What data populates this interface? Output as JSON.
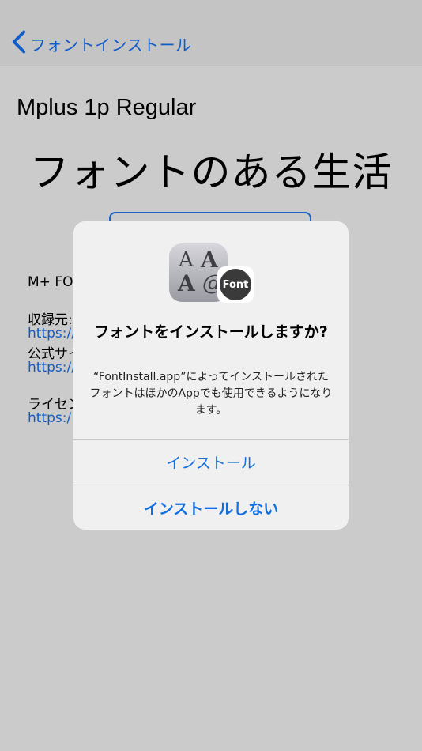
{
  "nav": {
    "back_label": "フォントインストール"
  },
  "font": {
    "name": "Mplus 1p Regular",
    "sample_text": "フォントのある生活"
  },
  "info": {
    "name_line": "M+ FON",
    "source_label": "収録元:",
    "source_link": "https://",
    "official_label": "公式サイ",
    "official_link": "https://",
    "license_label": "ライセン",
    "license_link": "https:/"
  },
  "dialog": {
    "icon": {
      "name": "font-app-icon",
      "letters": [
        "A",
        "A",
        "A",
        "@"
      ],
      "badge_text": "Font"
    },
    "title": "フォントをインストールしますか?",
    "message": "“FontInstall.app”によってインストールされたフォントはほかのAppでも使用できるようになります。",
    "install_label": "インストール",
    "dont_install_label": "インストールしない"
  },
  "colors": {
    "accent": "#0f5cc9",
    "dialog_button": "#1170e0"
  }
}
